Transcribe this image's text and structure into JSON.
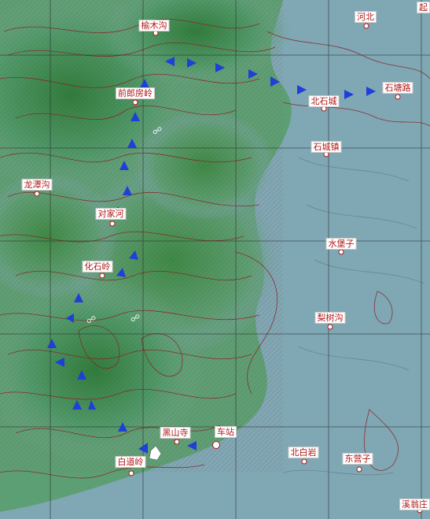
{
  "map": {
    "colors": {
      "relief_low": "#7fa7b4",
      "relief_mid": "#4f9a6a",
      "relief_high": "#2f7d3c",
      "contour": "#8a1f1f",
      "grid": "#2a2a2a",
      "route_arrow": "#1f3fd8",
      "label_text": "#b01818"
    },
    "places": [
      {
        "id": "yumugou",
        "name": "榆木沟"
      },
      {
        "id": "hebei",
        "name": "河北"
      },
      {
        "id": "qianlangfangling",
        "name": "前郎房岭"
      },
      {
        "id": "beishicheng",
        "name": "北石城"
      },
      {
        "id": "shitanglu",
        "name": "石塘路"
      },
      {
        "id": "shichengzhen",
        "name": "石城镇"
      },
      {
        "id": "longtangou",
        "name": "龙潭沟"
      },
      {
        "id": "duijiahe",
        "name": "对家河"
      },
      {
        "id": "shuibaozi",
        "name": "水堡子"
      },
      {
        "id": "huashiling",
        "name": "化石岭"
      },
      {
        "id": "lishugou",
        "name": "梨树沟"
      },
      {
        "id": "heishansi",
        "name": "黑山寺"
      },
      {
        "id": "chezhan",
        "name": "车站"
      },
      {
        "id": "baidaoling",
        "name": "白道岭"
      },
      {
        "id": "beibaiyan",
        "name": "北白岩"
      },
      {
        "id": "dongyingzi",
        "name": "东营子"
      },
      {
        "id": "xiwengzhuang",
        "name": "溪翁庄"
      },
      {
        "id": "corner_top_right",
        "name": "起"
      }
    ],
    "route_symbol": "arrow"
  }
}
